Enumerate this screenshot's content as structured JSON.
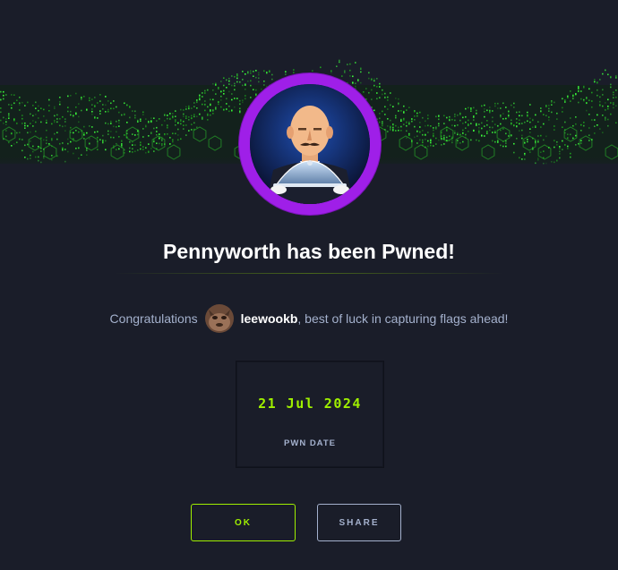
{
  "machine": {
    "title": "Pennyworth has been Pwned!"
  },
  "congrats": {
    "prefix": "Congratulations",
    "username": "leewookb",
    "suffix": ", best of luck in capturing flags ahead!"
  },
  "pwn": {
    "date": "21 Jul 2024",
    "label": "PWN DATE"
  },
  "buttons": {
    "ok": "OK",
    "share": "SHARE"
  },
  "colors": {
    "background": "#1a1d29",
    "accent_green": "#9fef00",
    "ring_purple": "#9f1fe8",
    "text_muted": "#a4b1cd"
  }
}
